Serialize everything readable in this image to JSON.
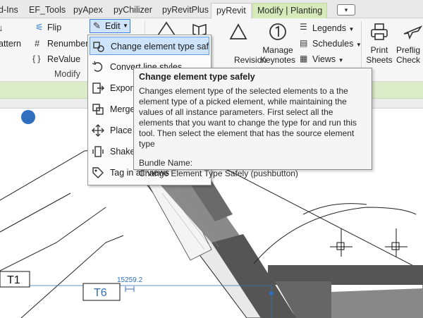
{
  "tabs": [
    "d-Ins",
    "EF_Tools",
    "pyApex",
    "pyChilizer",
    "pyRevitPlus",
    "pyRevit",
    "Modify | Planting"
  ],
  "tab_control": "▾",
  "ribbon": {
    "pattern_label": "attern",
    "flip_label": "Flip",
    "renumber_label": "Renumber",
    "revalue_label": "ReValue",
    "modify_label": "Modify",
    "edit_label": "Edit",
    "revision_label": "Revision",
    "manage_keynotes_label": "Manage\nKeynotes",
    "legends_label": "Legends",
    "schedules_label": "Schedules",
    "views_label": "Views",
    "print_sheets_label": "Print\nSheets",
    "preflight_label": "Preflig\nCheck"
  },
  "menu": {
    "items": [
      "Change element type safely",
      "Convert line styles",
      "Export",
      "Merge",
      "Place o",
      "Shake f",
      "Tag in all views"
    ]
  },
  "tooltip": {
    "title": "Change element type safely",
    "body": "Changes element type of the selected elements to a the element type of a picked element, while maintaining the values of all instance parameters. First select all the elements that you want to change the type for and run this tool. Then select the element that has the source element type",
    "bundle_label": "Bundle Name:",
    "bundle_value": "Change Element Type Safely (pushbutton)"
  },
  "drawing": {
    "tag_t1": "T1",
    "tag_t6": "T6",
    "dimension": "15259.2"
  },
  "colors": {
    "accent": "#2f6fbf",
    "context_green": "#dcecc9",
    "highlight": "#cde4fb"
  }
}
